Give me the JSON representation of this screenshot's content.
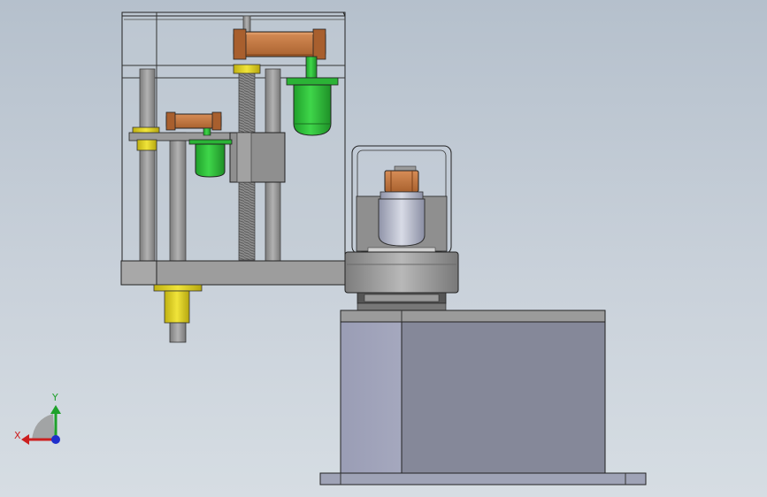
{
  "view": {
    "type": "cad-assembly-front-view",
    "background_top": "#b5c0cc",
    "background_bottom": "#d6dde3"
  },
  "assembly": {
    "components": [
      "left-gearbox-frame",
      "top-timing-belt",
      "large-green-motor",
      "lead-screw",
      "guide-rods",
      "small-timing-belt",
      "small-green-motor",
      "carriage-bracket",
      "yellow-bushings",
      "bottom-shaft",
      "cylinder-motor-cage",
      "orange-coupling",
      "silver-motor",
      "turntable-disc",
      "base-box",
      "base-plate"
    ],
    "colors": {
      "belt": "#c57a45",
      "motor_green": "#2fbf3a",
      "bushing_yellow": "#e0d21e",
      "metal_grey": "#8a8a8a",
      "base_box": "#878a9e",
      "base_box_side": "#9da1b8",
      "outline": "#1a1a1a"
    }
  },
  "triad": {
    "x_label": "X",
    "y_label": "Y",
    "x_color": "#cc1f1f",
    "y_color": "#1fa12b",
    "z_color": "#1f2fcc"
  }
}
